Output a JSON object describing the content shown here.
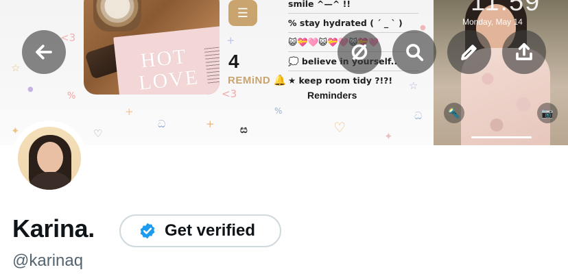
{
  "banner": {
    "reminders_widget": {
      "count": "4",
      "label": "REMiND",
      "bell": "🔔",
      "items": [
        "smile ^—^ !!",
        "% stay hydrated ( ´ _ ` )",
        "😺💝🩷😺💝🩷😺💝🩷",
        "💭 believe in yourself..",
        "★ keep room tidy ?!?!"
      ],
      "title": "Reminders",
      "list_icon": "list-icon"
    },
    "photo_widget": {
      "magazine_words": [
        "HOT",
        "LOVE"
      ]
    },
    "lockscreen": {
      "time": "11:59",
      "date": "Monday, May 14"
    }
  },
  "nav": {
    "back": "back-arrow-icon",
    "circle_off": "circle-slash-icon",
    "search": "search-icon",
    "edit": "pencil-icon",
    "share": "share-upload-icon"
  },
  "profile": {
    "display_name": "Karina.",
    "handle": "@karinaq",
    "verify_label": "Get verified",
    "verify_badge_color": "#1d9bf0"
  },
  "colors": {
    "accent_gold": "#c9a46f",
    "text_primary": "#0f1419",
    "text_secondary": "#536471",
    "button_border": "#cfd9de"
  }
}
